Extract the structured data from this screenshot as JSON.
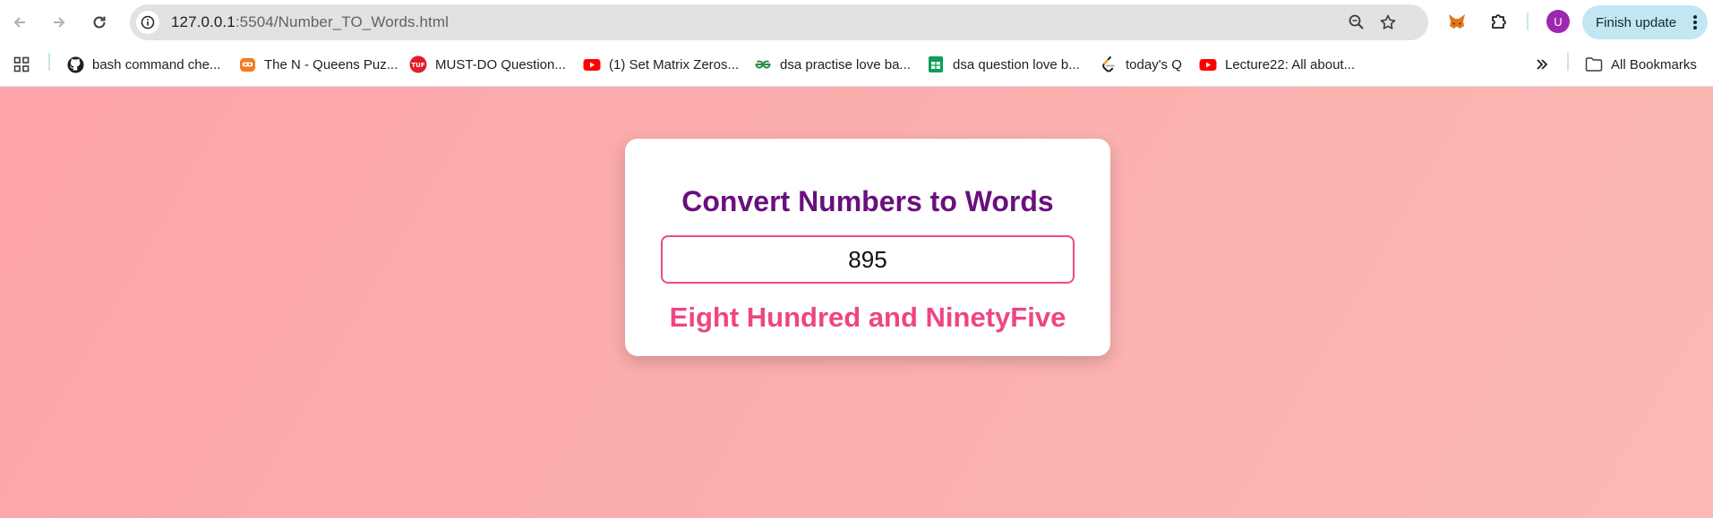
{
  "browser": {
    "url_host": "127.0.0.1",
    "url_path": ":5504/Number_TO_Words.html",
    "avatar_letter": "U",
    "finish_update_label": "Finish update"
  },
  "bookmarks": {
    "items": [
      {
        "label": "bash command che...",
        "icon": "github-icon"
      },
      {
        "label": "The N - Queens Puz...",
        "icon": "codingninjas-icon"
      },
      {
        "label": "MUST-DO Question...",
        "icon": "tuf-icon"
      },
      {
        "label": "(1) Set Matrix Zeros...",
        "icon": "youtube-icon"
      },
      {
        "label": "dsa practise love ba...",
        "icon": "geeksforgeeks-icon"
      },
      {
        "label": "dsa question love b...",
        "icon": "google-sheets-icon"
      },
      {
        "label": "today's Q",
        "icon": "leetcode-icon"
      },
      {
        "label": "Lecture22: All about...",
        "icon": "youtube-icon"
      }
    ],
    "all_bookmarks_label": "All Bookmarks"
  },
  "app": {
    "title": "Convert Numbers to Words",
    "input_value": "895",
    "result": "Eight Hundred and NinetyFive"
  },
  "colors": {
    "title": "#6a0f7e",
    "result": "#ee4584",
    "input_border": "#e84b8a",
    "background_start": "#fda4a8",
    "background_end": "#fbbab4"
  }
}
